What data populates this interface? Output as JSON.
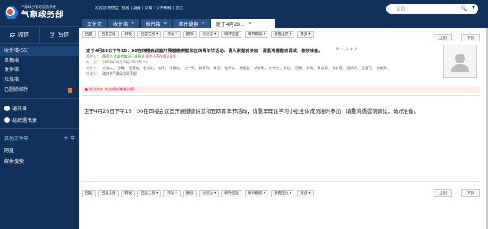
{
  "logo": {
    "line1": "气象政务管理信息系统",
    "line2": "气象政务部"
  },
  "compose": {
    "receive": "收信",
    "write": "写信"
  },
  "folders": [
    {
      "label": "收件箱(55)"
    },
    {
      "label": "草稿箱"
    },
    {
      "label": "发件箱"
    },
    {
      "label": "垃圾箱"
    },
    {
      "label": "已删除邮件"
    }
  ],
  "sidebar_links": {
    "contacts": "通讯录",
    "org_contacts": "组织通讯录",
    "other_folders": "其他文件夹",
    "other_folders_tools": "+ ✲",
    "folder_a": "网盘",
    "folder_b": "邮件搜索"
  },
  "header": {
    "welcome": "欢迎您:杨德全",
    "links": [
      "換膚",
      "設置",
      "反饋",
      "公共郵箱",
      "退出"
    ]
  },
  "search": {
    "value": "五四"
  },
  "tabs": [
    {
      "label": "文件夹"
    },
    {
      "label": "收件箱"
    },
    {
      "label": "发件箱"
    },
    {
      "label": "邮件搜索"
    },
    {
      "label": "定于4月28..."
    }
  ],
  "toolbar": {
    "buttons": [
      "回复",
      "回复全部",
      "转发",
      "回复全部 ▾",
      "转发 ▾",
      "删除",
      "标记为 ▾",
      "邮件回复",
      "邮件跟踪 ▾",
      "查看正文 ▾",
      "更多 ▾"
    ],
    "prev": "上封",
    "next": "下封"
  },
  "mail": {
    "subject": "定于4月28日下午15：00在四楼会议室开展道德讲堂和五四青年节活动，请大家提前参加，请重鸿儒提前调试，做好准备。",
    "subject_tools": "✉ ☆ ⚐ ▾ ⤢",
    "sender_label": "发件人：",
    "sender": "杨德全",
    "sender_note": "此邮件本源于本系统",
    "sender_warn": "发件人不在通讯录中",
    "recipients_label": "收件人：",
    "recipients": "方海人；   王馨；   王毓璐；   杜汉文；   张所；   汪景佳；   刘一平；   曾家明；   覃忍；   张平兵；   杨德全；   胡俊朝；   刘书杰；   张达；   汪湧；   李明；   黄汝桑；   吴财莲；   邵新丹；   王潘飞；   陈畅元；",
    "date_label": "时　间：",
    "date": "2022年04月28日 09:05(二)",
    "cc_label": "抄送人：",
    "cc": "政府参气象局党政干部",
    "read_notice": "发送状态",
    "read_link": "发送成功[查看详情]",
    "body": "定于4月28日下午15：00在四楼会议室开展道德讲堂和五四青年节活动，请重年理论学习小组全体成员准时参加，请重鸿儒提前调试，做好准备。"
  }
}
